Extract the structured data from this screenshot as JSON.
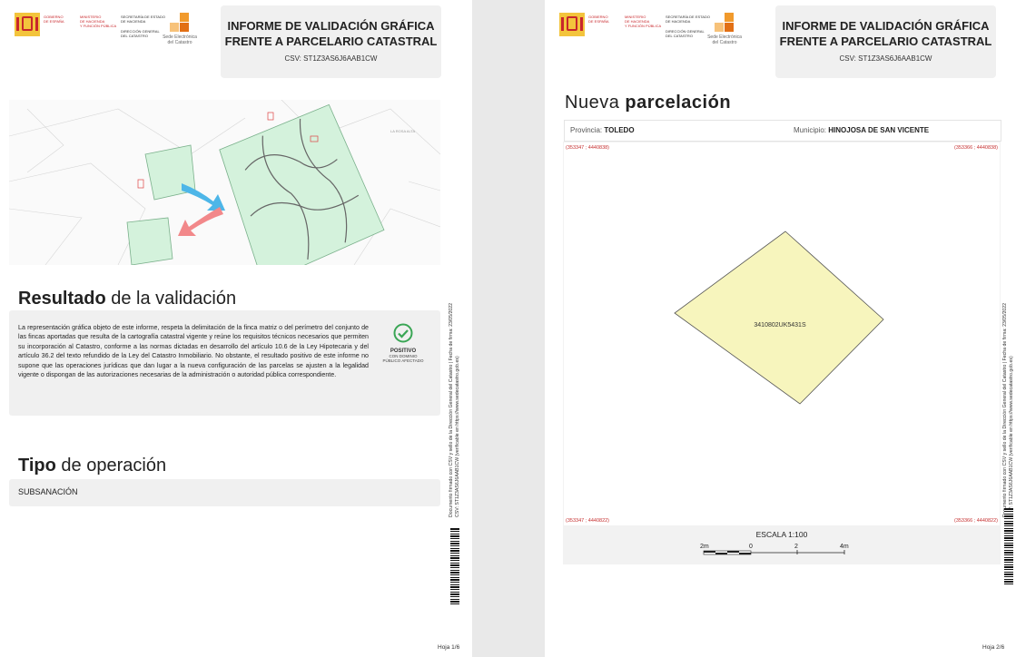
{
  "header": {
    "gov_line1": "GOBIERNO",
    "gov_line2": "DE ESPAÑA",
    "ministry_line1": "MINISTERIO",
    "ministry_line2": "DE HACIENDA",
    "ministry_line3": "Y FUNCIÓN PÚBLICA",
    "secretaria_line1": "SECRETARÍA DE ESTADO",
    "secretaria_line2": "DE HACIENDA",
    "direccion_line1": "DIRECCIÓN GENERAL",
    "direccion_line2": "DEL CATASTRO",
    "sede_line1": "Sede Electrónica",
    "sede_line2": "del Catastro",
    "title_line1": "INFORME DE VALIDACIÓN GRÁFICA",
    "title_line2": "FRENTE A PARCELARIO CATASTRAL",
    "csv": "CSV: ST1Z3AS6J6AAB1CW"
  },
  "page1": {
    "result_title_bold": "Resultado",
    "result_title_rest": " de la validación",
    "result_text": "La representación gráfica objeto de este informe, respeta la delimitación de la finca matriz o del perímetro del conjunto de las fincas aportadas que resulta de la cartografía catastral vigente y reúne los requisitos técnicos necesarios que permiten su incorporación al Catastro, conforme a las normas dictadas en desarrollo del artículo 10.6 de la Ley Hipotecaria y del artículo 36.2 del texto refundido de la Ley del Catastro Inmobiliario. No obstante, el resultado positivo de este informe no supone que las operaciones jurídicas que dan lugar a la nueva configuración de las parcelas se ajusten a la legalidad vigente o dispongan de las autorizaciones necesarias de la administración o autoridad pública correspondiente.",
    "badge_status": "POSITIVO",
    "badge_sub1": "CON DOMINIO",
    "badge_sub2": "PÚBLICO AFECTADO",
    "op_title_bold": "Tipo",
    "op_title_rest": " de operación",
    "op_value": "SUBSANACIÓN",
    "side_line1": "Documento firmado con CSV y sello de la Dirección General del Catastro  |  Fecha de firma: 23/05/2022",
    "side_line2": "CSV: ST1Z3AS6J6AAB1CW (verificable en https://www.sedecatastro.gob.es)",
    "hoja": "Hoja 1/6"
  },
  "page2": {
    "title_light": "Nueva ",
    "title_bold": "parcelación",
    "provincia_label": "Provincia: ",
    "provincia_value": "TOLEDO",
    "municipio_label": "Municipio: ",
    "municipio_value": "HINOJOSA DE SAN VICENTE",
    "coord_tl": "(353347 ; 4440838)",
    "coord_tr": "(353366 ; 4440838)",
    "coord_bl": "(353347 ; 4440822)",
    "coord_br": "(353366 ; 4440822)",
    "parcel_ref": "3410802UK5431S",
    "escala": "ESCALA 1:100",
    "scale_labels": [
      "2m",
      "0",
      "2",
      "4m"
    ],
    "side_line1": "Documento firmado con CSV y sello de la Dirección General del Catastro  |  Fecha de firma: 23/05/2022",
    "side_line2": "CSV: ST1Z3AS6J6AAB1CW (verificable en https://www.sedecatastro.gob.es)",
    "hoja": "Hoja 2/6"
  },
  "colors": {
    "parcel_fill": "#f7f5bd",
    "coord_red": "#c63030",
    "badge_green": "#3aa655",
    "puzzle_green": "#d4f2dc"
  }
}
